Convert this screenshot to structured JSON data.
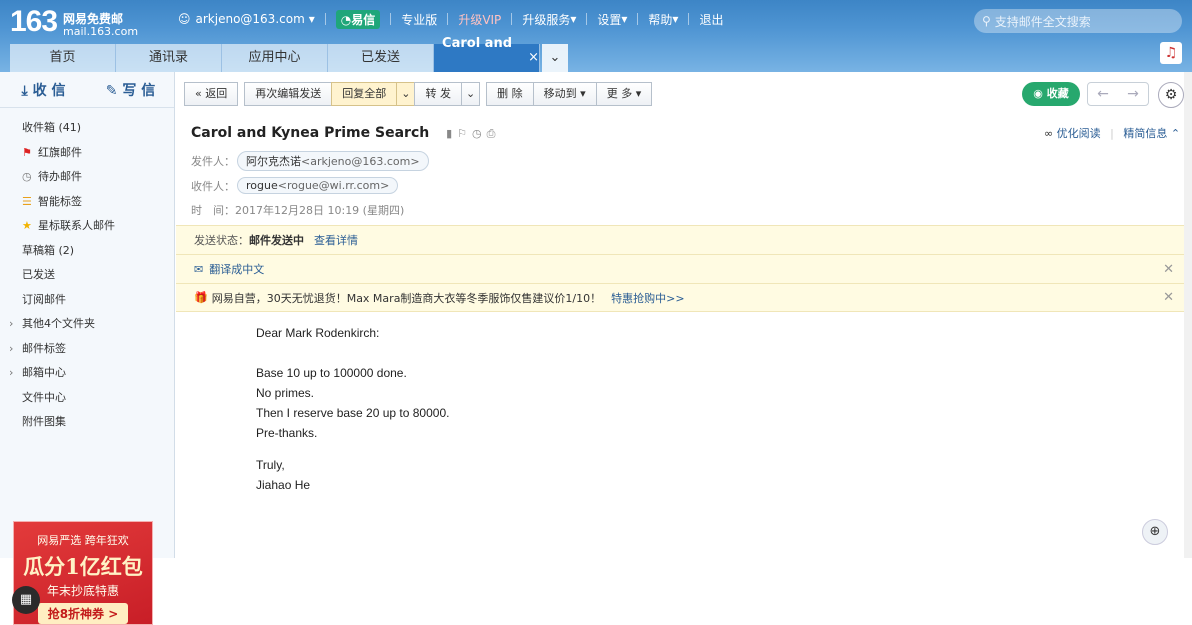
{
  "brand": {
    "logo_number": "163",
    "name": "网易免费邮",
    "domain": "mail.163.com"
  },
  "topnav": {
    "account": "arkjeno@163.com",
    "yixin": "易信",
    "pro": "专业版",
    "vip": "升级VIP",
    "upgrade": "升级服务",
    "settings": "设置",
    "help": "帮助",
    "logout": "退出"
  },
  "search": {
    "placeholder": "支持邮件全文搜索"
  },
  "tabs": [
    {
      "label": "首页"
    },
    {
      "label": "通讯录"
    },
    {
      "label": "应用中心"
    },
    {
      "label": "已发送"
    },
    {
      "label": "Carol and ..."
    }
  ],
  "sidebar": {
    "receive": "收 信",
    "compose": "写 信",
    "folders": [
      {
        "label": "收件箱 (41)"
      },
      {
        "label": "红旗邮件"
      },
      {
        "label": "待办邮件"
      },
      {
        "label": "智能标签"
      },
      {
        "label": "星标联系人邮件"
      },
      {
        "label": "草稿箱 (2)"
      },
      {
        "label": "已发送"
      },
      {
        "label": "订阅邮件"
      },
      {
        "label": "其他4个文件夹"
      },
      {
        "label": "邮件标签"
      },
      {
        "label": "邮箱中心"
      },
      {
        "label": "文件中心"
      },
      {
        "label": "附件图集"
      }
    ],
    "ad": {
      "line1": "网易严选 跨年狂欢",
      "line2": "瓜分1亿红包",
      "line3": "年末抄底特惠",
      "button": "抢8折神券 >"
    }
  },
  "toolbar": {
    "back": "返回",
    "resend": "再次编辑发送",
    "reply_all": "回复全部",
    "forward": "转 发",
    "delete": "删 除",
    "move": "移动到",
    "more": "更 多",
    "favorite": "收藏"
  },
  "message": {
    "subject": "Carol and Kynea Prime Search",
    "optimize_read": "优化阅读",
    "details": "精简信息",
    "from_label": "发件人：",
    "from_name": "阿尔克杰诺",
    "from_addr": "<arkjeno@163.com>",
    "to_label": "收件人：",
    "to_name": "rogue",
    "to_addr": "<rogue@wi.rr.com>",
    "time_label": "时　间：",
    "time": "2017年12月28日 10:19 (星期四)",
    "status_label": "发送状态：",
    "status_value": "邮件发送中",
    "status_link": "查看详情",
    "translate": "翻译成中文",
    "promo": "网易自营，30天无忧退货！Max Mara制造商大衣等冬季服饰仅售建议价1/10！",
    "promo_link": "特惠抢购中>>",
    "body": {
      "greeting": "Dear Mark Rodenkirch:",
      "l1": "Base 10 up to 100000 done.",
      "l2": "No primes.",
      "l3": "Then I reserve base 20 up to 80000.",
      "l4": "Pre-thanks.",
      "closing": "Truly,",
      "signature": "Jiahao He"
    }
  },
  "colors": {
    "header": "#4f95d3",
    "active_tab": "#2e79c4",
    "favorite": "#27a86e",
    "notice_bg": "#fffbe2"
  }
}
